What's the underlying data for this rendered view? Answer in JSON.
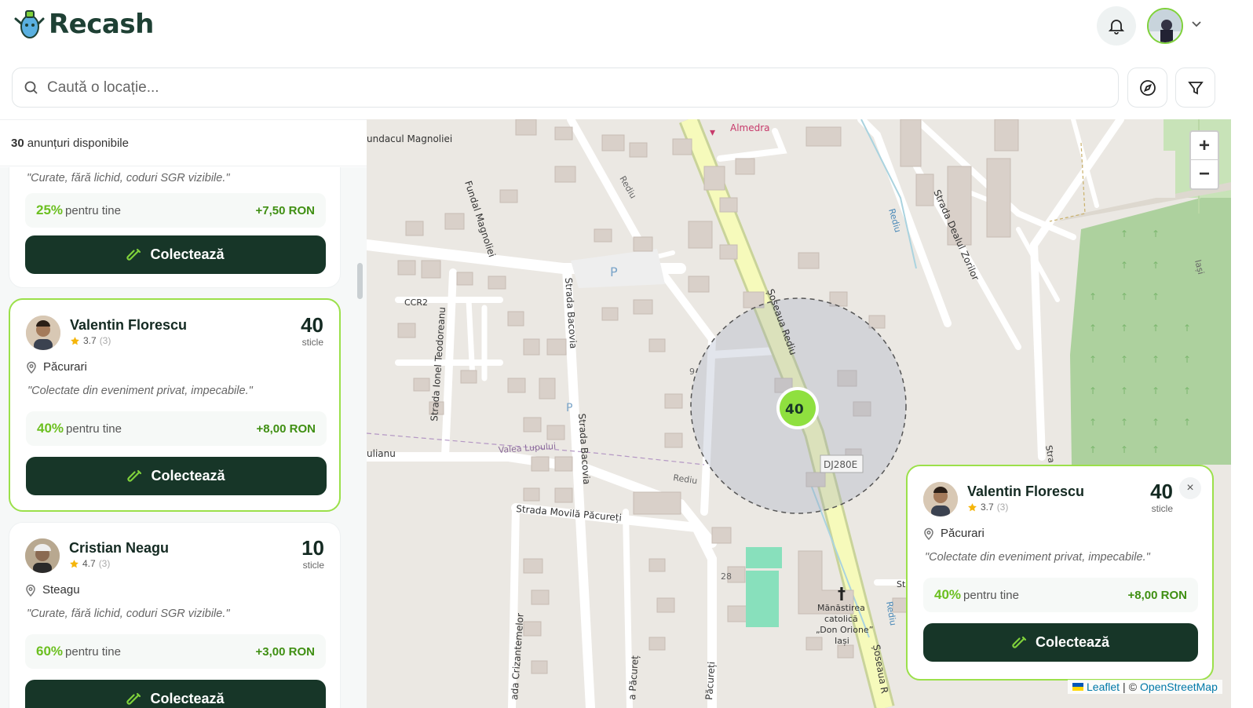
{
  "app": {
    "name": "Recash"
  },
  "search": {
    "placeholder": "Caută o locație..."
  },
  "sidebar": {
    "count": "30",
    "count_label": "anunțuri disponibile",
    "partial_card": {
      "quote": "\"Curate, fără lichid, coduri SGR vizibile.\"",
      "pct": "25%",
      "pct_label": "pentru tine",
      "ron": "+7,50 RON",
      "button": "Colectează"
    },
    "cards": [
      {
        "name": "Valentin Florescu",
        "rating": "3.7",
        "rating_count": "(3)",
        "number": "40",
        "unit": "sticle",
        "location": "Păcurari",
        "quote": "\"Colectate din eveniment privat, impecabile.\"",
        "pct": "40%",
        "pct_label": "pentru tine",
        "ron": "+8,00 RON",
        "button": "Colectează"
      },
      {
        "name": "Cristian Neagu",
        "rating": "4.7",
        "rating_count": "(3)",
        "number": "10",
        "unit": "sticle",
        "location": "Steagu",
        "quote": "\"Curate, fără lichid, coduri SGR vizibile.\"",
        "pct": "60%",
        "pct_label": "pentru tine",
        "ron": "+3,00 RON",
        "button": "Colectează"
      }
    ]
  },
  "map": {
    "marker_count": "40",
    "labels": {
      "almedra": "Almedra",
      "fundacul": "undacul Magnoliei",
      "fundal": "Fundal Magnoliei",
      "ccr2": "CCR2",
      "bacovia1": "Strada Bacovia",
      "bacovia2": "Strada Bacovia",
      "teodoreanu": "Strada Ionel Teodoreanu",
      "soseaua": "Șoseaua Rediu",
      "soseaua2": "Șoseaua R",
      "rediu1": "Rediu",
      "rediu2": "Rediu",
      "rediu3": "Rediu",
      "rediu4": "Rediu",
      "dealul": "Strada Dealul Zorilor",
      "dj": "DJ280E",
      "valea": "Valea Lupului",
      "ulianu": "ulianu",
      "movila": "Strada Movilă Păcureți",
      "crizantemelor": "ada Crizantemelor",
      "pacuret": "a Păcureț",
      "pacureti": "Păcureți",
      "n28": "28",
      "n9": "9",
      "p1": "P",
      "p2": "P",
      "iasi": "Iași",
      "manastirea": "Mănăstirea",
      "catolica": "catolică",
      "donorione": "„Don Orione”",
      "iasi2": "Iași",
      "st": "St",
      "stra": "Stra"
    },
    "zoom_in": "+",
    "zoom_out": "−",
    "attribution": {
      "leaflet": "Leaflet",
      "sep": "|",
      "copy": "©",
      "osm": "OpenStreetMap"
    }
  },
  "popup": {
    "name": "Valentin Florescu",
    "rating": "3.7",
    "rating_count": "(3)",
    "number": "40",
    "unit": "sticle",
    "location": "Păcurari",
    "quote": "\"Colectate din eveniment privat, impecabile.\"",
    "pct": "40%",
    "pct_label": "pentru tine",
    "ron": "+8,00 RON",
    "button": "Colectează",
    "close": "×"
  },
  "colors": {
    "brand_dark": "#173628",
    "accent_green": "#7fd13b",
    "ron_green": "#3f8f12"
  }
}
